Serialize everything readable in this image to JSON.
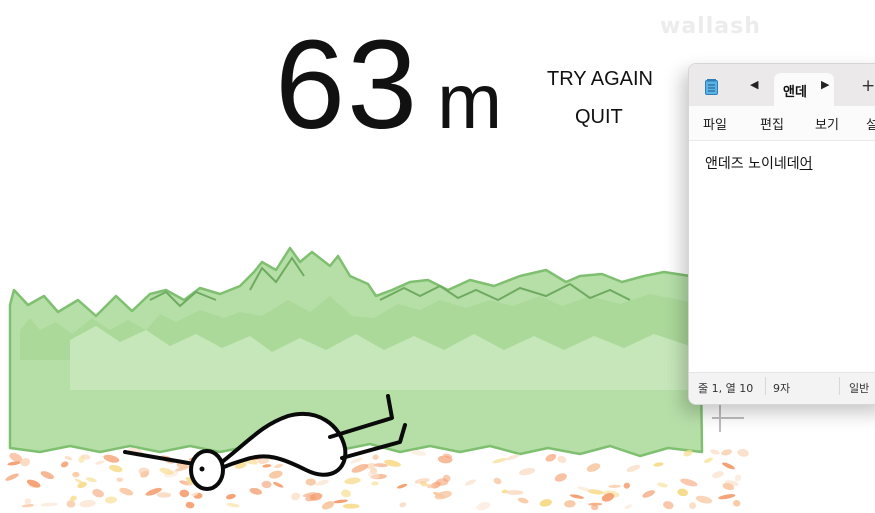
{
  "score": {
    "value": "63",
    "unit": "m"
  },
  "menu": {
    "try_again": "TRY AGAIN",
    "quit": "QUIT"
  },
  "watermark": "wallash",
  "notepad": {
    "tab_label": "앤데",
    "nav_prev": "◀",
    "nav_next": "▶",
    "new_tab": "+",
    "menus": [
      "파일",
      "편집",
      "보기",
      "설"
    ],
    "content_text": "앤데즈 노이네데",
    "content_composing": "어",
    "status": {
      "position": "줄 1, 열 10",
      "chars": "9자",
      "encoding": "일반"
    }
  },
  "colors": {
    "bush_light": "#b6dfa8",
    "bush_mid": "#9fd48c",
    "bush_dark_outline": "#6faa61",
    "leaf_peach": "#f8c9a4",
    "leaf_orange": "#f4a072",
    "leaf_yellow": "#f7dc8c"
  }
}
